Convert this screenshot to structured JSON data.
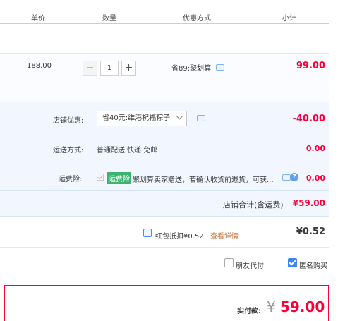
{
  "header": {
    "col_price": "单价",
    "col_qty": "数量",
    "col_promo": "优惠方式",
    "col_subtotal": "小计"
  },
  "item": {
    "unit_price": "188.00",
    "quantity": "1",
    "minus_label": "−",
    "plus_label": "+",
    "promo_text": "省89:聚划算",
    "subtotal": "99.00"
  },
  "shop": {
    "discount_label": "店铺优惠:",
    "discount_select": "省40元:维港祝福粽子",
    "discount_value": "-40.00",
    "shipping_label": "运送方式:",
    "shipping_text": "普通配送 快递 免邮",
    "shipping_value": "0.00",
    "insurance_label": "运费险:",
    "insurance_tag": "运费险",
    "insurance_text": "聚划算卖家赠送，若确认收货前退货，可获...",
    "insurance_value": "0.00",
    "total_label": "店铺合计(含运费)",
    "total_value": "¥59.00"
  },
  "redpacket": {
    "label": "红包抵扣¥0.52",
    "details_link": "查看详情",
    "value": "¥0.52"
  },
  "options": {
    "friend_pay": "朋友代付",
    "anonymous": "匿名购买"
  },
  "payment": {
    "label": "实付款:",
    "currency": "¥",
    "amount": "59.00"
  },
  "colors": {
    "accent_red": "#ff0036",
    "shop_bg": "#f2f7ff",
    "check_blue": "#3a87f0"
  }
}
